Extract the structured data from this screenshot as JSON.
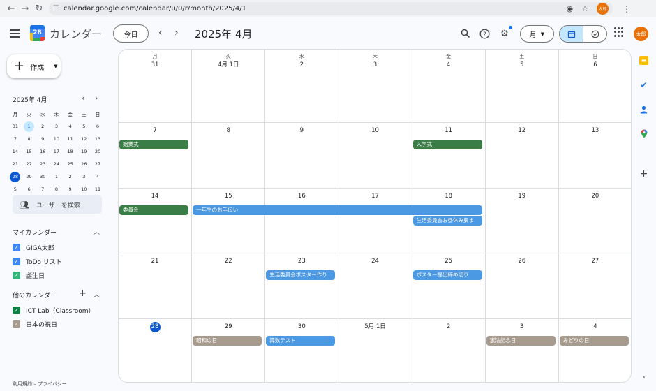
{
  "browser": {
    "url": "calendar.google.com/calendar/u/0/r/month/2025/4/1",
    "profile_label": "太郎"
  },
  "header": {
    "app_name": "カレンダー",
    "logo_day": "28",
    "today_label": "今日",
    "period_title": "2025年 4月",
    "view_label": "月",
    "account_label": "太郎"
  },
  "sidebar": {
    "create_label": "作成",
    "mini_title": "2025年 4月",
    "mini_weekdays": [
      "月",
      "火",
      "水",
      "木",
      "金",
      "土",
      "日"
    ],
    "mini_weeks": [
      [
        "31",
        "1",
        "2",
        "3",
        "4",
        "5",
        "6"
      ],
      [
        "7",
        "8",
        "9",
        "10",
        "11",
        "12",
        "13"
      ],
      [
        "14",
        "15",
        "16",
        "17",
        "18",
        "19",
        "20"
      ],
      [
        "21",
        "22",
        "23",
        "24",
        "25",
        "26",
        "27"
      ],
      [
        "28",
        "29",
        "30",
        "1",
        "2",
        "3",
        "4"
      ],
      [
        "5",
        "6",
        "7",
        "8",
        "9",
        "10",
        "11"
      ]
    ],
    "search_people": "ユーザーを検索",
    "my_calendars_title": "マイカレンダー",
    "my_calendars": [
      {
        "name": "GIGA太郎",
        "color": "#4285f4"
      },
      {
        "name": "ToDo リスト",
        "color": "#4285f4"
      },
      {
        "name": "誕生日",
        "color": "#33b679"
      }
    ],
    "other_calendars_title": "他のカレンダー",
    "other_calendars": [
      {
        "name": "ICT Lab（Classroom）",
        "color": "#0b8043"
      },
      {
        "name": "日本の祝日",
        "color": "#a79b8e"
      }
    ],
    "footer": "利用規約 – プライバシー"
  },
  "month": {
    "weekdays": [
      "月",
      "火",
      "水",
      "木",
      "金",
      "土",
      "日"
    ],
    "weeks": [
      [
        "31",
        "4月 1日",
        "2",
        "3",
        "4",
        "5",
        "6"
      ],
      [
        "7",
        "8",
        "9",
        "10",
        "11",
        "12",
        "13"
      ],
      [
        "14",
        "15",
        "16",
        "17",
        "18",
        "19",
        "20"
      ],
      [
        "21",
        "22",
        "23",
        "24",
        "25",
        "26",
        "27"
      ],
      [
        "28",
        "29",
        "30",
        "5月 1日",
        "2",
        "3",
        "4"
      ]
    ],
    "today": {
      "week": 4,
      "day": 0
    },
    "events": [
      {
        "title": "始業式",
        "week": 1,
        "start": 0,
        "span": 1,
        "lane": 0,
        "color": "#3b7d46"
      },
      {
        "title": "入学式",
        "week": 1,
        "start": 4,
        "span": 1,
        "lane": 0,
        "color": "#3b7d46"
      },
      {
        "title": "委員会",
        "week": 2,
        "start": 0,
        "span": 1,
        "lane": 0,
        "color": "#3b7d46"
      },
      {
        "title": "一年生のお手伝い",
        "week": 2,
        "start": 1,
        "span": 4,
        "lane": 0,
        "color": "#4b99e2"
      },
      {
        "title": "生活委員会お昼休み集ま",
        "week": 2,
        "start": 4,
        "span": 1,
        "lane": 1,
        "color": "#4b99e2"
      },
      {
        "title": "生活委員会ポスター作り",
        "week": 3,
        "start": 2,
        "span": 1,
        "lane": 0,
        "color": "#4b99e2"
      },
      {
        "title": "ポスター提出締め切り",
        "week": 3,
        "start": 4,
        "span": 1,
        "lane": 0,
        "color": "#4b99e2"
      },
      {
        "title": "昭和の日",
        "week": 4,
        "start": 1,
        "span": 1,
        "lane": 0,
        "color": "#a79b8e"
      },
      {
        "title": "算数テスト",
        "week": 4,
        "start": 2,
        "span": 1,
        "lane": 0,
        "color": "#4b99e2"
      },
      {
        "title": "憲法記念日",
        "week": 4,
        "start": 5,
        "span": 1,
        "lane": 0,
        "color": "#a79b8e"
      },
      {
        "title": "みどりの日",
        "week": 4,
        "start": 6,
        "span": 1,
        "lane": 0,
        "color": "#a79b8e"
      }
    ]
  },
  "rail_icons": [
    "keep-icon",
    "tasks-icon",
    "contacts-icon",
    "maps-icon",
    "add-icon",
    "expand-icon"
  ]
}
